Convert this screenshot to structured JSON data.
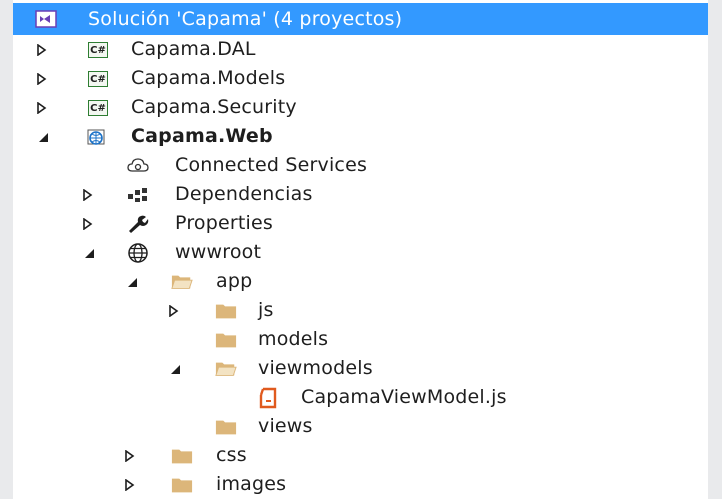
{
  "tree": {
    "solution_label": "Solución 'Capama'  (4 proyectos)",
    "items": [
      {
        "label": "Capama.DAL"
      },
      {
        "label": "Capama.Models"
      },
      {
        "label": "Capama.Security"
      },
      {
        "label": "Capama.Web"
      },
      {
        "label": "Connected Services"
      },
      {
        "label": "Dependencias"
      },
      {
        "label": "Properties"
      },
      {
        "label": "wwwroot"
      },
      {
        "label": "app"
      },
      {
        "label": "js"
      },
      {
        "label": "models"
      },
      {
        "label": "viewmodels"
      },
      {
        "label": "CapamaViewModel.js"
      },
      {
        "label": "views"
      },
      {
        "label": "css"
      },
      {
        "label": "images"
      }
    ]
  },
  "colors": {
    "selection": "#3399ff",
    "folder": "#dcb67a",
    "csharp_border": "#2e7d32",
    "js_file": "#e05a1e",
    "web_globe": "#1e73c8"
  }
}
